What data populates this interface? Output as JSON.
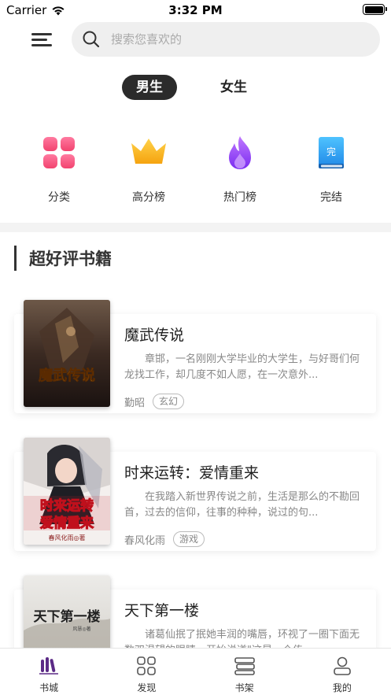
{
  "status_bar": {
    "carrier": "Carrier",
    "time": "3:32 PM"
  },
  "search": {
    "placeholder": "搜索您喜欢的"
  },
  "gender_tabs": [
    {
      "label": "男生",
      "active": true
    },
    {
      "label": "女生",
      "active": false
    }
  ],
  "categories": [
    {
      "label": "分类",
      "icon": "grid-icon",
      "color": "#f24e7a"
    },
    {
      "label": "高分榜",
      "icon": "crown-icon",
      "color": "#f9b21c"
    },
    {
      "label": "热门榜",
      "icon": "flame-icon",
      "color": "#8b3dff"
    },
    {
      "label": "完结",
      "icon": "book-complete-icon",
      "color": "#2d9cf0",
      "icon_text": "完"
    }
  ],
  "section": {
    "title": "超好评书籍"
  },
  "books": [
    {
      "title": "魔武传说",
      "description": "章邯，一名刚刚大学毕业的大学生，与好哥们何龙找工作，却几度不如人愿，在一次意外...",
      "author": "勤昭",
      "tag": "玄幻",
      "cover_text": "魔武传说"
    },
    {
      "title": "时来运转：爱情重来",
      "description": "在我踏入新世界传说之前，生活是那么的不勘回首，过去的信仰，往事的种种，说过的句...",
      "author": "春风化雨",
      "tag": "游戏",
      "cover_text_1": "时来运转",
      "cover_text_2": "爱情重来",
      "cover_author": "春风化雨◎著"
    },
    {
      "title": "天下第一楼",
      "description": "诸葛仙抿了抿她丰润的嘴唇，环视了一圈下面无数双渴望的眼睛，开始说道\"这是一个传...",
      "author": "",
      "tag": "",
      "cover_text": "天下第一楼",
      "cover_author": "风慧◎著"
    }
  ],
  "tabbar": [
    {
      "label": "书城",
      "icon": "bookstore-icon",
      "active": true
    },
    {
      "label": "发现",
      "icon": "discover-icon",
      "active": false
    },
    {
      "label": "书架",
      "icon": "bookshelf-icon",
      "active": false
    },
    {
      "label": "我的",
      "icon": "profile-icon",
      "active": false
    }
  ],
  "colors": {
    "accent": "#5b2a86",
    "dark_pill": "#2b2b2b"
  }
}
